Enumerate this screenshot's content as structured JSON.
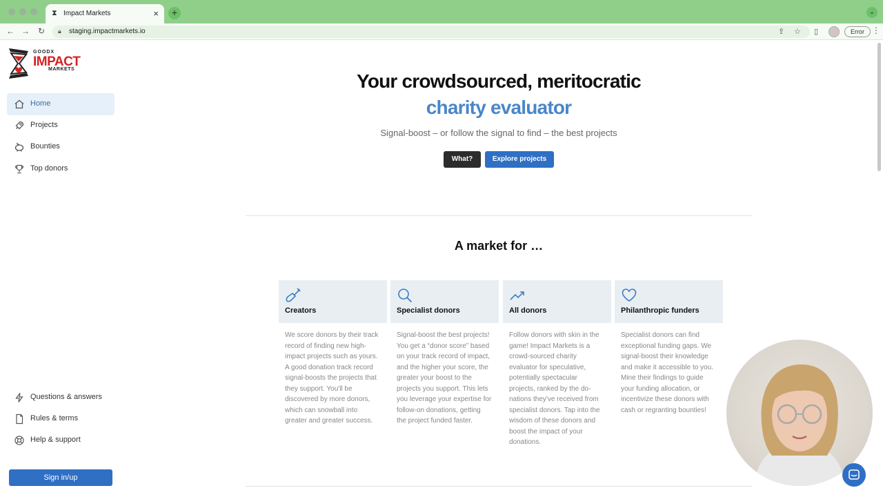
{
  "browser": {
    "tab_title": "Impact Markets",
    "url": "staging.impactmarkets.io",
    "error_label": "Error"
  },
  "logo": {
    "top": "GOODX",
    "main": "IMPACT",
    "sub": "MARKETS"
  },
  "sidebar": {
    "items": [
      {
        "label": "Home",
        "icon": "home-icon",
        "active": true
      },
      {
        "label": "Projects",
        "icon": "rocket-icon",
        "active": false
      },
      {
        "label": "Bounties",
        "icon": "piggy-bank-icon",
        "active": false
      },
      {
        "label": "Top donors",
        "icon": "trophy-icon",
        "active": false
      }
    ],
    "footer_items": [
      {
        "label": "Questions & answers",
        "icon": "lightning-icon"
      },
      {
        "label": "Rules & terms",
        "icon": "document-icon"
      },
      {
        "label": "Help & support",
        "icon": "lifebuoy-icon"
      }
    ],
    "signin_label": "Sign in/up"
  },
  "hero": {
    "title": "Your crowdsourced, meritocratic",
    "accent": "charity evaluator",
    "subtitle": "Signal-boost – or follow the signal to find – the best projects",
    "what_button": "What?",
    "explore_button": "Explore projects"
  },
  "market": {
    "title": "A market for …",
    "cards": [
      {
        "title": "Creators",
        "icon": "shovel-icon",
        "text": "We score donors by their track record of finding new high-impact projects such as yours. A good donation track record signal-boosts the projects that they sup­port. You'll be discovered by more donors, which can snowball into greater and greater success."
      },
      {
        "title": "Specialist donors",
        "icon": "magnifier-icon",
        "text": "Signal-boost the best projects! You get a “donor score” based on your track record of impact, and the higher your score, the greater your boost to the projects you support. This lets you leverage your ex­pertise for follow-on dona­tions, getting the project funded faster."
      },
      {
        "title": "All donors",
        "icon": "trending-up-icon",
        "text": "Follow donors with skin in the game! Impact Markets is a crowd-sourced charity evaluator for speculative, potentially spectacular projects, ranked by the do­nations they've received from specialist donors. Tap into the wisdom of these donors and boost the impact of your donations."
      },
      {
        "title": "Philanthropic funders",
        "icon": "heart-icon",
        "text": "Specialist donors can find exceptional funding gaps. We signal-boost their knowl­edge and make it accessible to you. Mine their findings to guide your funding alloca­tion, or incentivize these donors with cash or regrant­ing bounties!"
      }
    ]
  },
  "colors": {
    "accent": "#4a86c8",
    "primary_button": "#2f6fc4",
    "brand_red": "#d32424",
    "chrome_green": "#8fcf8a"
  }
}
